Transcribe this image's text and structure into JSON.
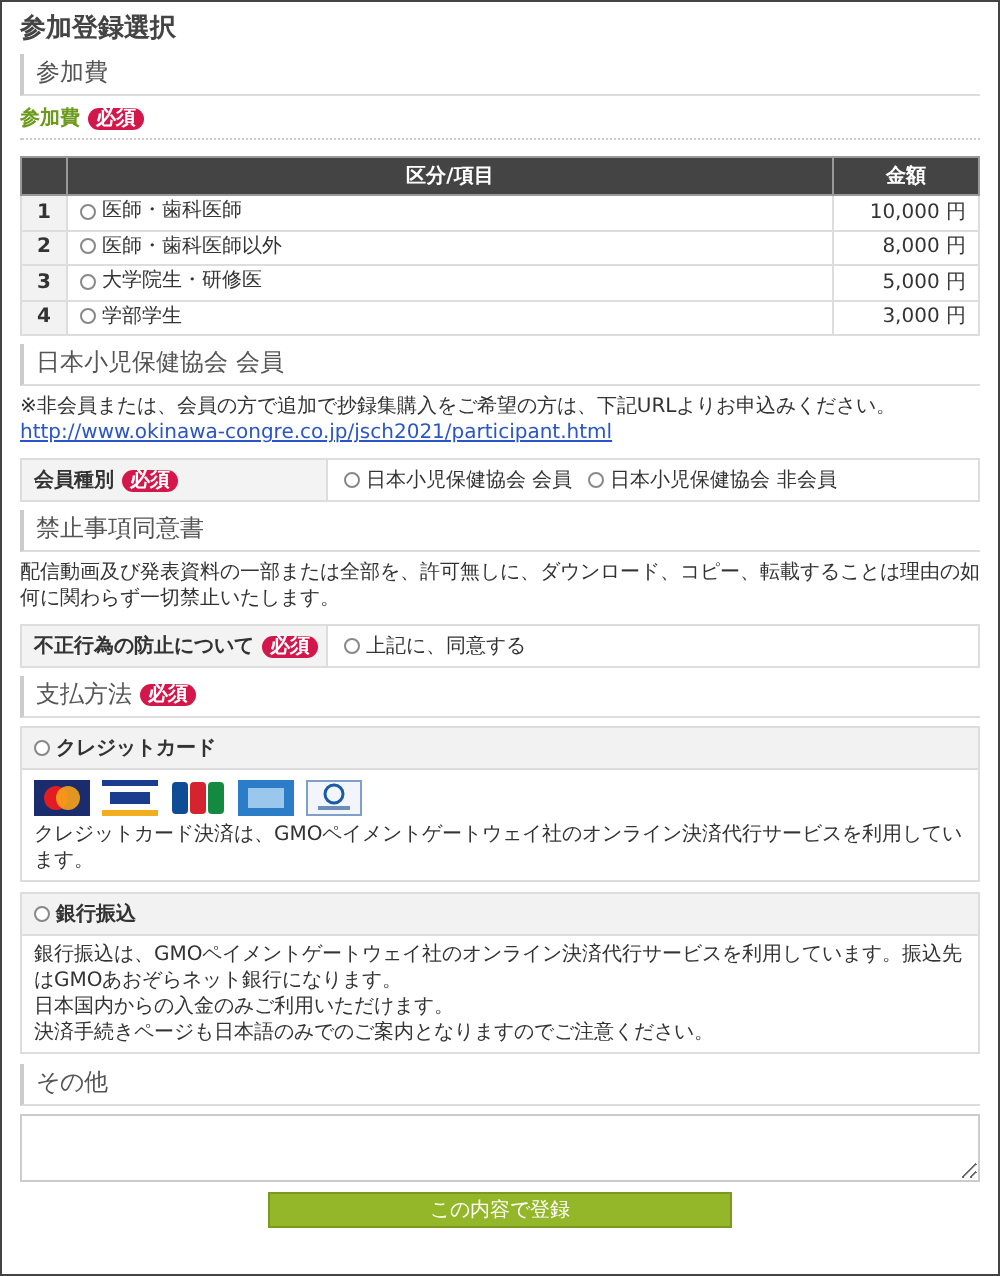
{
  "page_title": "参加登録選択",
  "fee_section": {
    "heading": "参加費",
    "label": "参加費",
    "required_badge": "必須",
    "table": {
      "columns": [
        "区分/項目",
        "金額"
      ],
      "rows": [
        {
          "number": "1",
          "option": "医師・歯科医師",
          "selected": false,
          "amount": "10,000 円"
        },
        {
          "number": "2",
          "option": "医師・歯科医師以外",
          "selected": false,
          "amount": "8,000 円"
        },
        {
          "number": "3",
          "option": "大学院生・研修医",
          "selected": false,
          "amount": "5,000 円"
        },
        {
          "number": "4",
          "option": "学部学生",
          "selected": false,
          "amount": "3,000 円"
        }
      ]
    }
  },
  "membership_section": {
    "heading": "日本小児保健協会 会員",
    "note": "※非会員または、会員の方で追加で抄録集購入をご希望の方は、下記URLよりお申込みください。",
    "link": "http://www.okinawa-congre.co.jp/jsch2021/participant.html",
    "field": {
      "label": "会員種別",
      "required_badge": "必須",
      "options": [
        {
          "label": "日本小児保健協会 会員",
          "selected": false
        },
        {
          "label": "日本小児保健協会 非会員",
          "selected": false
        }
      ]
    }
  },
  "consent_section": {
    "heading": "禁止事項同意書",
    "text": "配信動画及び発表資料の一部または全部を、許可無しに、ダウンロード、コピー、転載することは理由の如何に関わらず一切禁止いたします。",
    "field": {
      "label": "不正行為の防止について",
      "required_badge": "必須",
      "options": [
        {
          "label": "上記に、同意する",
          "selected": false
        }
      ]
    }
  },
  "payment_section": {
    "heading": "支払方法",
    "required_badge": "必須",
    "methods": [
      {
        "kind": "card",
        "label": "クレジットカード",
        "selected": false,
        "description": [
          "クレジットカード決済は、GMOペイメントゲートウェイ社のオンライン決済代行サービスを利用しています。"
        ]
      },
      {
        "kind": "bank",
        "label": "銀行振込",
        "selected": false,
        "description": [
          "銀行振込は、GMOペイメントゲートウェイ社のオンライン決済代行サービスを利用しています。振込先はGMOあおぞらネット銀行になります。",
          "日本国内からの入金のみご利用いただけます。",
          "決済手続きページも日本語のみでのご案内となりますのでご注意ください。"
        ]
      }
    ]
  },
  "other_section": {
    "heading": "その他"
  },
  "submit_button": "この内容で登録"
}
